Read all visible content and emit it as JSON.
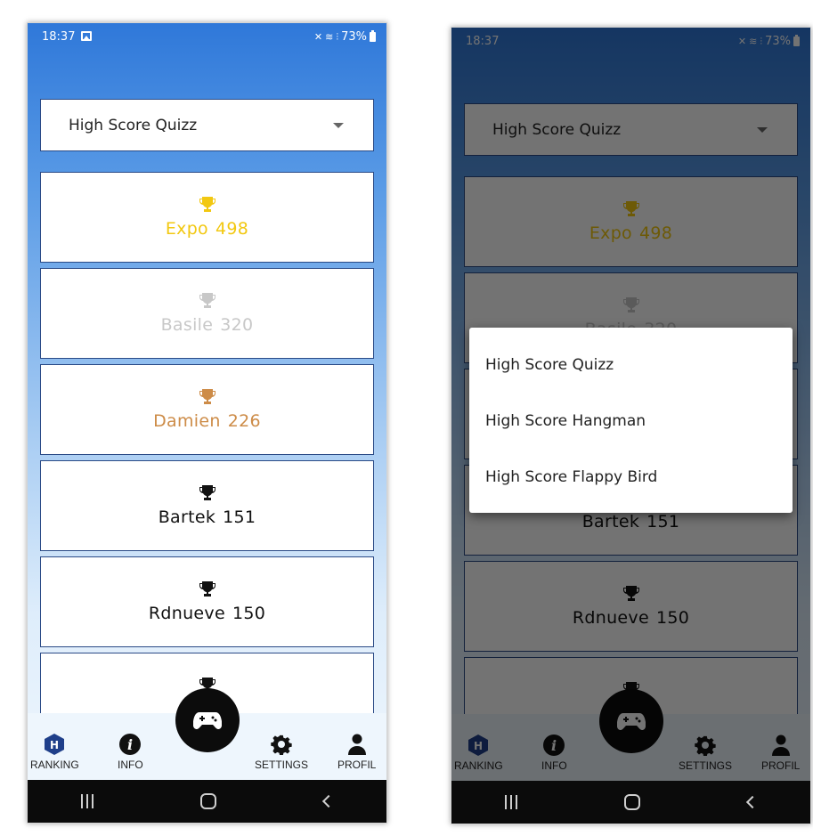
{
  "status": {
    "time": "18:37",
    "battery": "73%"
  },
  "dropdown": {
    "selected": "High Score Quizz"
  },
  "ranking": [
    {
      "name": "Expo",
      "score": "498",
      "color": "#f2c811"
    },
    {
      "name": "Basile",
      "score": "320",
      "color": "#c8c8c8"
    },
    {
      "name": "Damien",
      "score": "226",
      "color": "#cd8c48"
    },
    {
      "name": "Bartek",
      "score": "151",
      "color": "#111111"
    },
    {
      "name": "Rdnueve",
      "score": "150",
      "color": "#111111"
    },
    {
      "name": "",
      "score": "",
      "color": "#111111"
    }
  ],
  "nav": {
    "ranking": "RANKING",
    "info": "INFO",
    "settings": "SETTINGS",
    "profil": "PROFIL"
  },
  "menu": {
    "options": [
      "High Score Quizz",
      "High Score Hangman",
      "High Score Flappy Bird"
    ]
  },
  "colors": {
    "accent": "#1f3f8a",
    "gradient_top": "#2f78d9"
  }
}
